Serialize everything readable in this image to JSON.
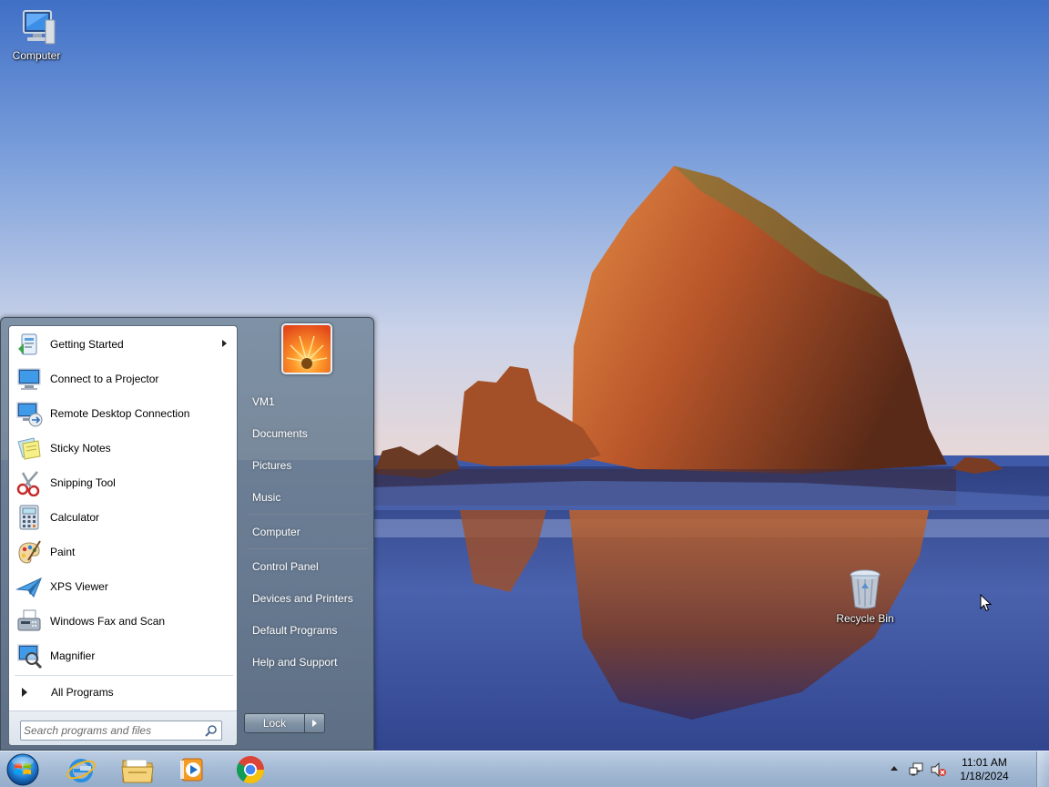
{
  "desktop": {
    "icons": [
      {
        "label": "Computer"
      },
      {
        "label": "Recycle Bin"
      }
    ]
  },
  "start_menu": {
    "programs": [
      {
        "label": "Getting Started",
        "icon": "getting-started-icon",
        "has_submenu": true
      },
      {
        "label": "Connect to a Projector",
        "icon": "projector-icon"
      },
      {
        "label": "Remote Desktop Connection",
        "icon": "remote-desktop-icon"
      },
      {
        "label": "Sticky Notes",
        "icon": "sticky-notes-icon"
      },
      {
        "label": "Snipping Tool",
        "icon": "scissors-icon"
      },
      {
        "label": "Calculator",
        "icon": "calculator-icon"
      },
      {
        "label": "Paint",
        "icon": "paint-palette-icon"
      },
      {
        "label": "XPS Viewer",
        "icon": "xps-viewer-icon"
      },
      {
        "label": "Windows Fax and Scan",
        "icon": "fax-icon"
      },
      {
        "label": "Magnifier",
        "icon": "magnifier-icon"
      }
    ],
    "all_programs": "All Programs",
    "search": {
      "placeholder": "Search programs and files",
      "value": ""
    },
    "right_items": [
      {
        "label": "VM1"
      },
      {
        "label": "Documents"
      },
      {
        "label": "Pictures"
      },
      {
        "label": "Music"
      },
      {
        "label": "Computer"
      },
      {
        "label": "Control Panel"
      },
      {
        "label": "Devices and Printers"
      },
      {
        "label": "Default Programs"
      },
      {
        "label": "Help and Support"
      }
    ],
    "lock_label": "Lock"
  },
  "taskbar": {
    "pinned": [
      {
        "name": "Internet Explorer",
        "icon": "internet-explorer-icon"
      },
      {
        "name": "Windows Explorer",
        "icon": "folder-icon"
      },
      {
        "name": "Windows Media Player",
        "icon": "media-player-icon"
      },
      {
        "name": "Google Chrome",
        "icon": "chrome-icon"
      }
    ],
    "clock": {
      "time": "11:01 AM",
      "date": "1/18/2024"
    }
  },
  "colors": {
    "sky_top": "#3f71c6",
    "rock": "#c1612a",
    "sea": "#2b3f86",
    "taskbar": "#aac0d8",
    "start_orb": "#1f7fd6"
  }
}
